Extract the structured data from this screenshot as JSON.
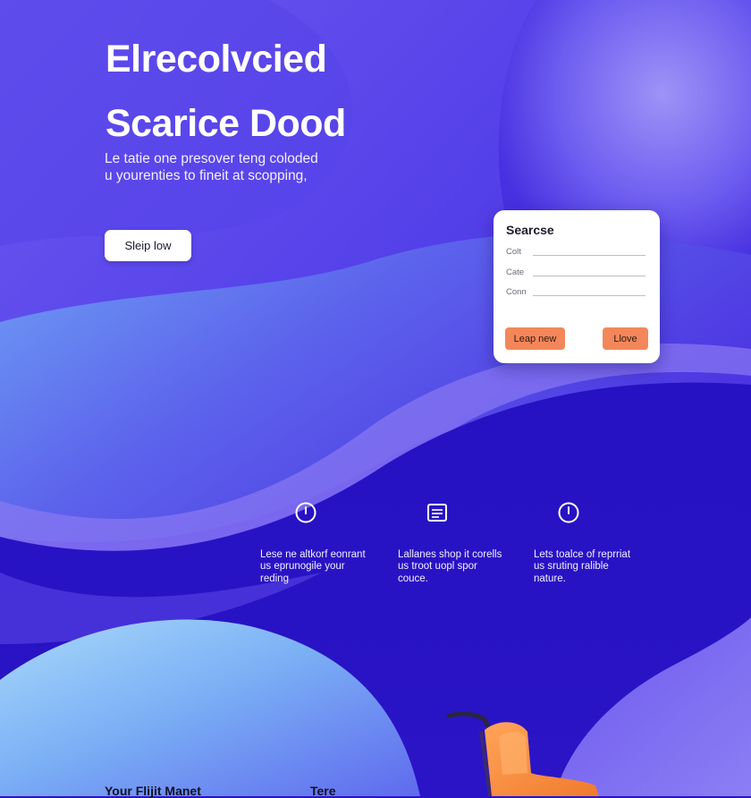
{
  "hero": {
    "title_line1": "Elrecolvcied",
    "title_line2": "Scarice Dood",
    "subtitle_line1": "Le tatie one presover teng coloded",
    "subtitle_line2": "u yourenties to fineit at scopping,",
    "cta_label": "Sleip low"
  },
  "search_card": {
    "title": "Searcse",
    "fields": [
      {
        "label": "Colt"
      },
      {
        "label": "Cate"
      },
      {
        "label": "Conn"
      }
    ],
    "primary_button": "Leap new",
    "secondary_button": "Llove"
  },
  "features": [
    {
      "icon": "clock-icon",
      "lines": [
        "Lese ne altkorf eonrant",
        "us eprunogile your",
        "reding"
      ]
    },
    {
      "icon": "document-icon",
      "lines": [
        "Lallanes shop it corells",
        "us troot uopl spor",
        "couce."
      ]
    },
    {
      "icon": "clock-icon",
      "lines": [
        "Lets toalce of reprriat",
        "us sruting ralible",
        "nature."
      ]
    }
  ],
  "footer": {
    "left_heading": "Your Flijit Manet",
    "right_heading": "Tere"
  },
  "colors": {
    "background": "#2a12c8",
    "accent": "#f4875a",
    "card": "#ffffff"
  }
}
